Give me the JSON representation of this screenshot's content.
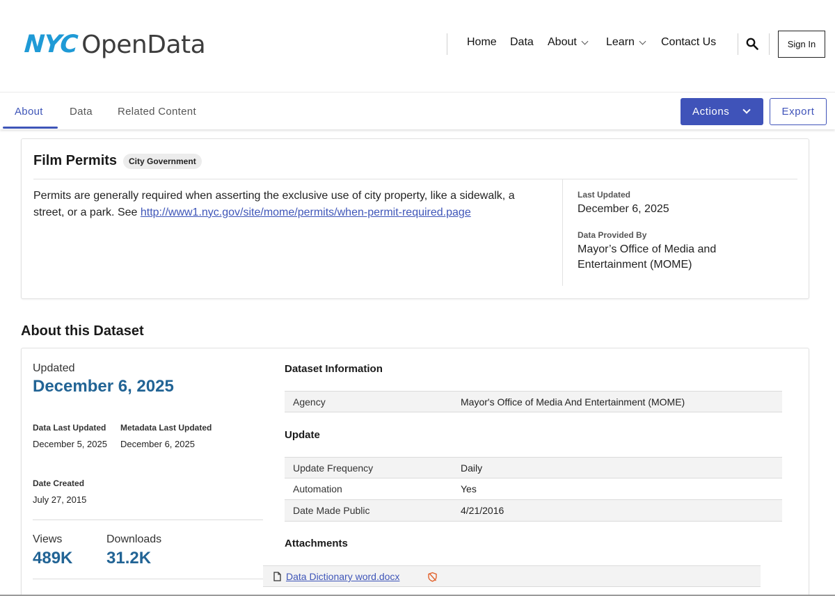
{
  "header": {
    "logo_nyc": "NYC",
    "logo_opendata": "OpenData",
    "nav": [
      {
        "label": "Home",
        "has_dropdown": false
      },
      {
        "label": "Data",
        "has_dropdown": false
      },
      {
        "label": "About",
        "has_dropdown": true
      },
      {
        "label": "Learn",
        "has_dropdown": true
      },
      {
        "label": "Contact Us",
        "has_dropdown": false
      }
    ],
    "search_icon": "search-icon",
    "signin_label": "Sign In"
  },
  "tabs": [
    {
      "label": "About",
      "active": true
    },
    {
      "label": "Data",
      "active": false
    },
    {
      "label": "Related Content",
      "active": false
    }
  ],
  "toolbar": {
    "actions_label": "Actions",
    "export_label": "Export"
  },
  "summary": {
    "title": "Film Permits",
    "category": "City Government",
    "description_text": "Permits are generally required when asserting the exclusive use of city property, like a sidewalk, a street, or a park. See ",
    "description_link": "http://www1.nyc.gov/site/mome/permits/when-permit-required.page",
    "last_updated_label": "Last Updated",
    "last_updated_value": "December 6, 2025",
    "provided_by_label": "Data Provided By",
    "provided_by_value": "Mayor’s Office of Media and Entertainment (MOME)"
  },
  "about": {
    "heading": "About this Dataset",
    "updated_label": "Updated",
    "updated_value": "December 6, 2025",
    "data_last_updated_label": "Data Last Updated",
    "data_last_updated_value": "December 5, 2025",
    "metadata_last_updated_label": "Metadata Last Updated",
    "metadata_last_updated_value": "December 6, 2025",
    "date_created_label": "Date Created",
    "date_created_value": "July 27, 2015",
    "views_label": "Views",
    "views_value": "489K",
    "downloads_label": "Downloads",
    "downloads_value": "31.2K",
    "dataset_info_heading": "Dataset Information",
    "agency_key": "Agency",
    "agency_value": "Mayor's Office of Media And Entertainment (MOME)",
    "update_heading": "Update",
    "update_rows": [
      {
        "key": "Update Frequency",
        "value": "Daily"
      },
      {
        "key": "Automation",
        "value": "Yes"
      },
      {
        "key": "Date Made Public",
        "value": "4/21/2016"
      }
    ],
    "attachments_heading": "Attachments",
    "attachment_name": "Data Dictionary word.docx"
  },
  "colors": {
    "accent": "#3f53b9",
    "stat_blue": "#226495",
    "logo_blue": "#1f9ad6",
    "warn_orange": "#e2612b"
  }
}
